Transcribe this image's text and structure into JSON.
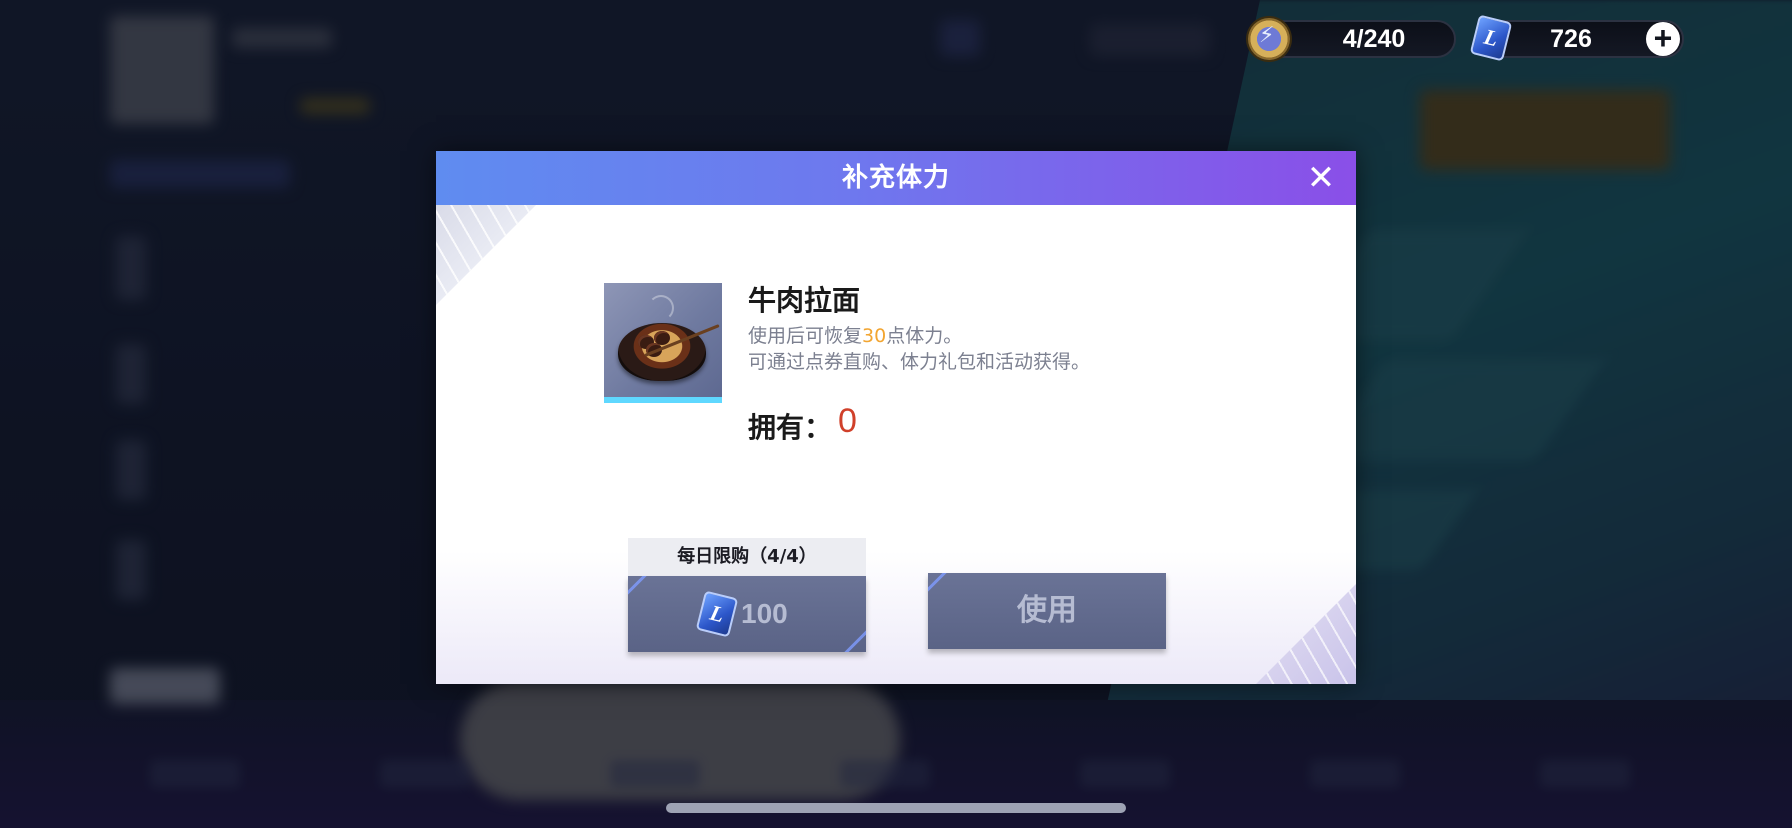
{
  "resources": {
    "stamina": {
      "icon": "stamina-bolt-icon",
      "value": "4/240"
    },
    "tickets": {
      "icon": "ticket-icon",
      "glyph": "L",
      "value": "726"
    },
    "add_icon": "plus-icon"
  },
  "dialog": {
    "title": "补充体力",
    "close_icon": "close-icon",
    "item": {
      "icon": "beef-ramen-icon",
      "name": "牛肉拉面",
      "desc_line1_prefix": "使用后可恢复",
      "desc_line1_value": "30",
      "desc_line1_suffix": "点体力。",
      "desc_line2": "可通过点券直购、体力礼包和活动获得。",
      "owned_label": "拥有：",
      "owned_value": "0"
    },
    "buy": {
      "limit_label": "每日限购（4/4）",
      "currency_glyph": "L",
      "price": "100"
    },
    "use": {
      "label": "使用"
    }
  },
  "colors": {
    "header_start": "#5f8cf0",
    "header_end": "#8a4fe8",
    "highlight": "#f2a531",
    "owned_value": "#d0402a",
    "button": "#636c8f"
  }
}
